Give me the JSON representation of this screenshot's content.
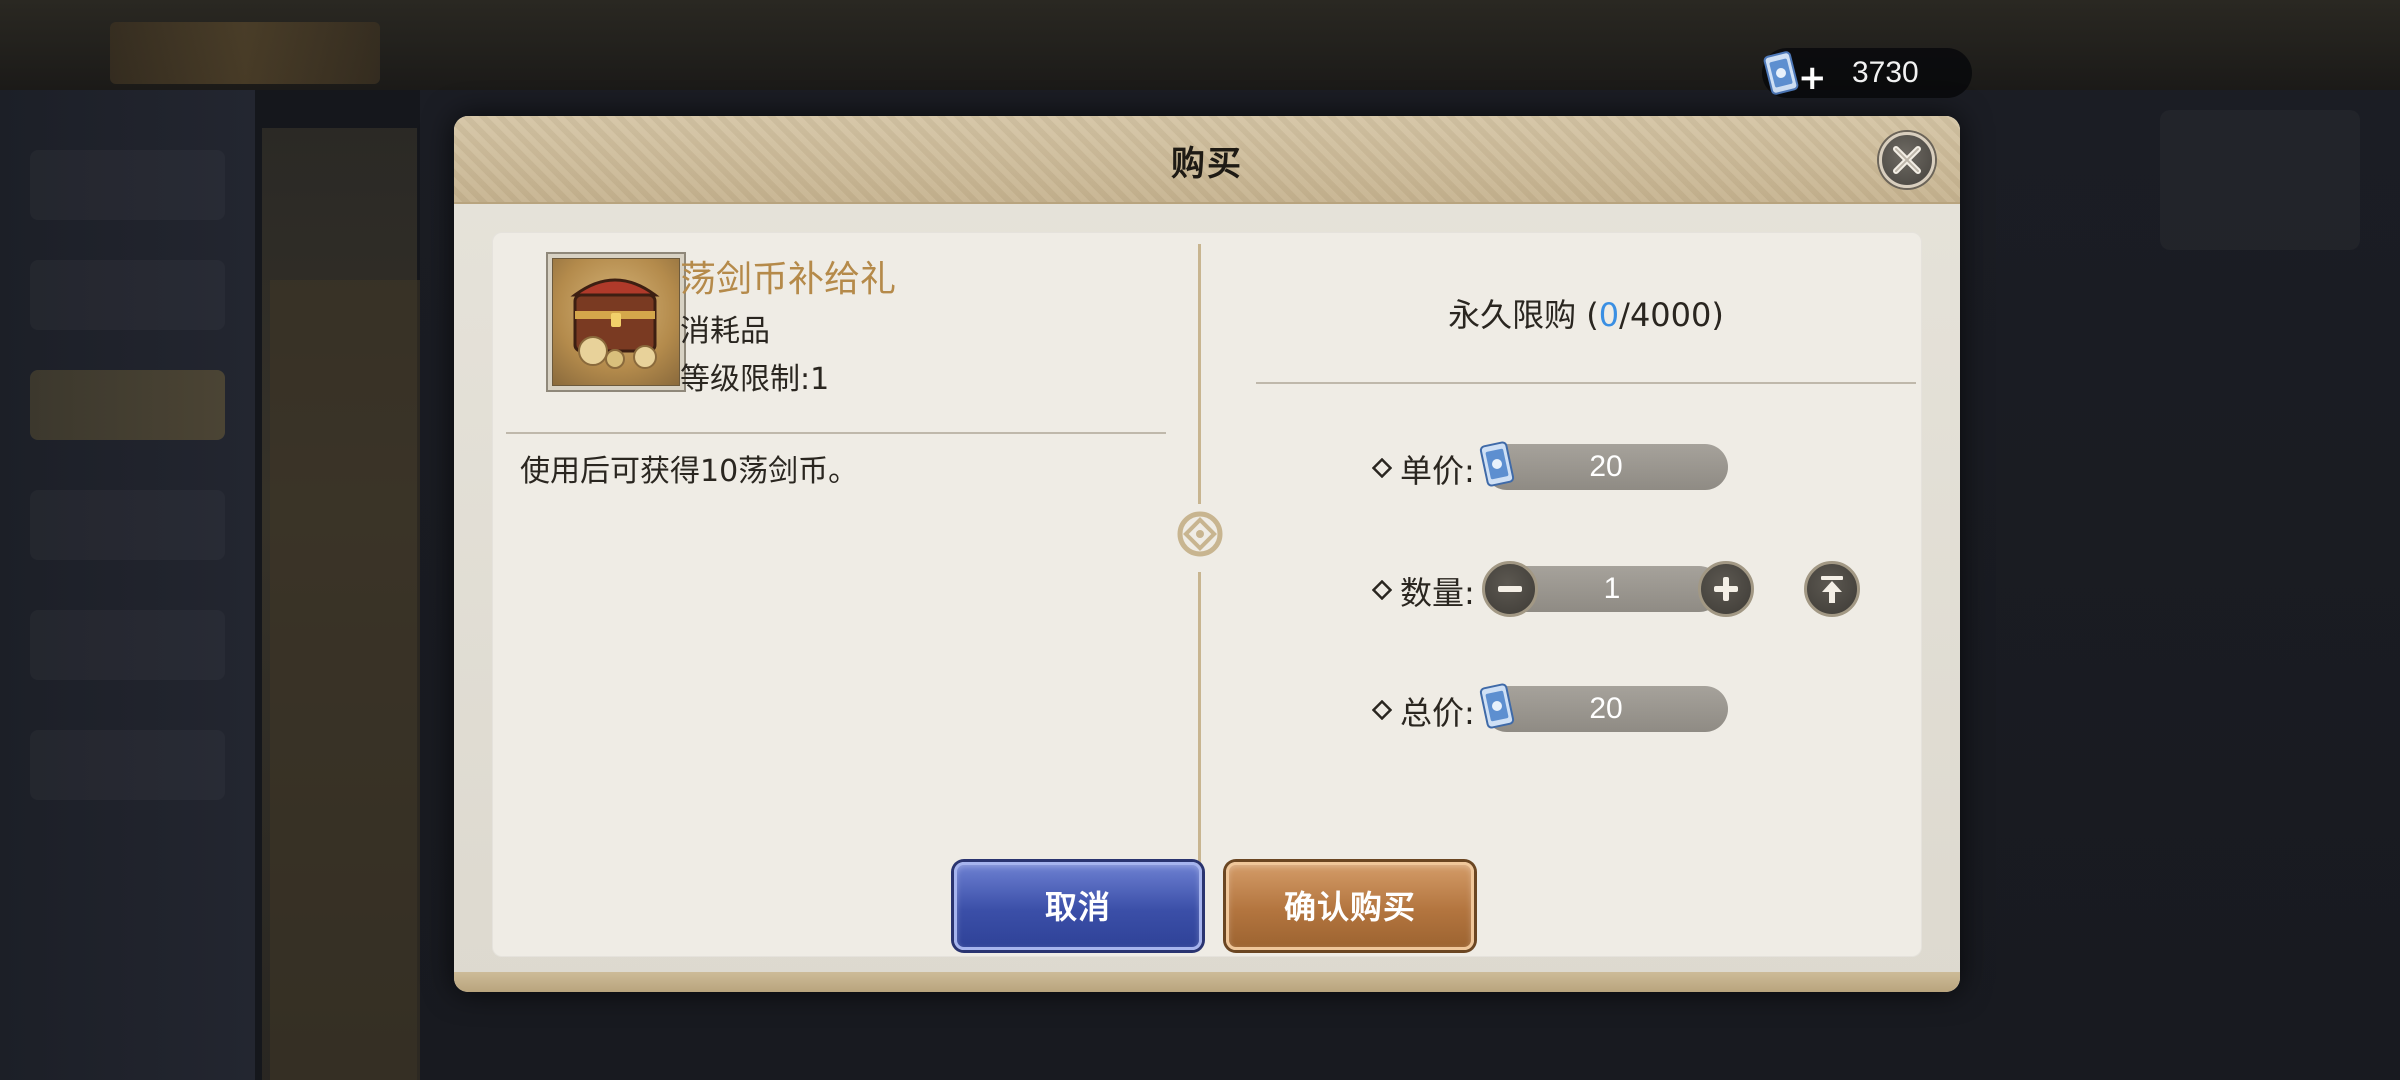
{
  "currency": {
    "amount": "3730",
    "icon": "scroll-ticket-icon",
    "add_icon": "plus-icon"
  },
  "dialog": {
    "title": "购买",
    "close_icon": "close-icon",
    "item": {
      "name": "荡剑币补给礼",
      "type": "消耗品",
      "level_limit": "等级限制:1",
      "description": "使用后可获得10荡剑币。"
    },
    "purchase_limit": {
      "label": "永久限购 (",
      "current": "0",
      "separator": "/",
      "max": "4000",
      "close": ")"
    },
    "unit_price": {
      "label": "单价:",
      "value": "20"
    },
    "quantity": {
      "label": "数量:",
      "value": "1"
    },
    "total_price": {
      "label": "总价:",
      "value": "20"
    },
    "buttons": {
      "cancel": "取消",
      "confirm": "确认购买"
    }
  },
  "colors": {
    "item_name": "#b58a4a",
    "limit_current": "#3a8fe3",
    "cancel_button": "#3b4fa8",
    "confirm_button": "#b3753f"
  }
}
